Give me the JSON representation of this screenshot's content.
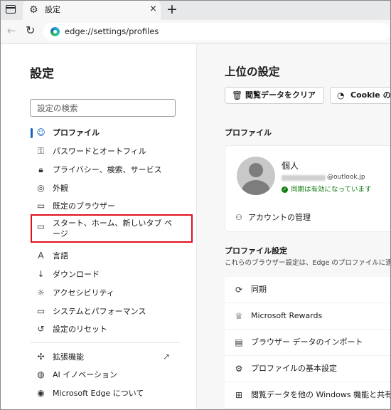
{
  "tab": {
    "icon": "gear-icon",
    "title": "設定",
    "close": "×"
  },
  "new_tab": "+",
  "toolbar": {
    "back": "←",
    "refresh": "↻",
    "url": "edge://settings/profiles"
  },
  "sidebar": {
    "title": "設定",
    "search_placeholder": "設定の検索",
    "items": [
      {
        "label": "プロファイル",
        "icon": "profile-icon",
        "active": true
      },
      {
        "label": "パスワードとオートフィル",
        "icon": "key-icon"
      },
      {
        "label": "プライバシー、検索、サービス",
        "icon": "lock-icon"
      },
      {
        "label": "外観",
        "icon": "palette-icon"
      },
      {
        "label": "既定のブラウザー",
        "icon": "browser-icon"
      },
      {
        "label": "スタート、ホーム、新しいタブ ページ",
        "label_line1": "スタート、ホーム、新しいタブ ペ",
        "label_line2": "ージ",
        "icon": "home-tab-icon"
      },
      {
        "label": "言語",
        "icon": "language-icon"
      },
      {
        "label": "ダウンロード",
        "icon": "download-icon"
      },
      {
        "label": "アクセシビリティ",
        "icon": "accessibility-icon"
      },
      {
        "label": "システムとパフォーマンス",
        "icon": "system-icon"
      },
      {
        "label": "設定のリセット",
        "icon": "reset-icon"
      },
      {
        "label": "拡張機能",
        "icon": "extensions-icon"
      },
      {
        "label": "AI イノベーション",
        "icon": "ai-icon"
      },
      {
        "label": "Microsoft Edge について",
        "icon": "edge-icon"
      }
    ],
    "highlight_color": "#e0101e"
  },
  "main": {
    "title": "上位の設定",
    "buttons": [
      {
        "label": "閲覧データをクリア",
        "icon": "trash-icon"
      },
      {
        "label": "Cookie の管",
        "icon": "cookie-icon"
      }
    ],
    "profile_section_title": "プロファイル",
    "profile": {
      "name": "個人",
      "email_domain": "@outlook.jp",
      "sync_status": "同期は有効になっています",
      "manage_account": "アカウントの管理"
    },
    "settings_section_title": "プロファイル設定",
    "settings_description": "これらのブラウザー設定は、Edge のプロファイルに適",
    "settings_items": [
      {
        "label": "同期",
        "icon": "sync-icon"
      },
      {
        "label": "Microsoft Rewards",
        "icon": "rewards-icon"
      },
      {
        "label": "ブラウザー データのインポート",
        "icon": "import-icon"
      },
      {
        "label": "プロファイルの基本設定",
        "icon": "profile-settings-icon"
      },
      {
        "label": "閲覧データを他の Windows 機能と共有",
        "icon": "windows-icon"
      }
    ]
  },
  "colors": {
    "accent": "#1264c6",
    "sync_green": "#107c10"
  }
}
